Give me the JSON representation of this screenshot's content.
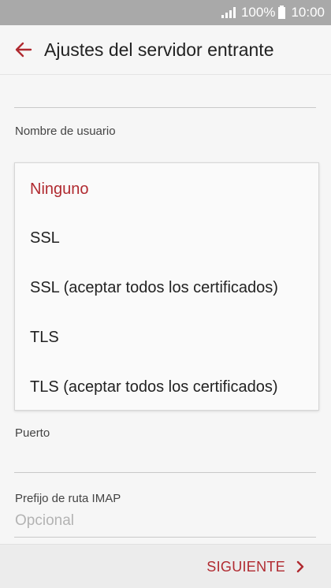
{
  "status_bar": {
    "battery": "100%",
    "time": "10:00",
    "icons": [
      "signal-icon",
      "battery-icon"
    ]
  },
  "app_bar": {
    "back_icon": "arrow-left-icon",
    "title": "Ajustes del servidor entrante"
  },
  "form": {
    "username_label": "Nombre de usuario",
    "port_label": "Puerto",
    "imap_prefix_label": "Prefijo de ruta IMAP",
    "imap_prefix_placeholder": "Opcional"
  },
  "security_dropdown": {
    "options": [
      "Ninguno",
      "SSL",
      "SSL (aceptar todos los certificados)",
      "TLS",
      "TLS (aceptar todos los certificados)"
    ],
    "selected": "Ninguno"
  },
  "bottom_bar": {
    "next_label": "SIGUIENTE",
    "next_icon": "chevron-right-icon"
  },
  "colors": {
    "accent": "#b02a30",
    "status_bar": "#a9a9a9",
    "background": "#f6f6f6"
  }
}
